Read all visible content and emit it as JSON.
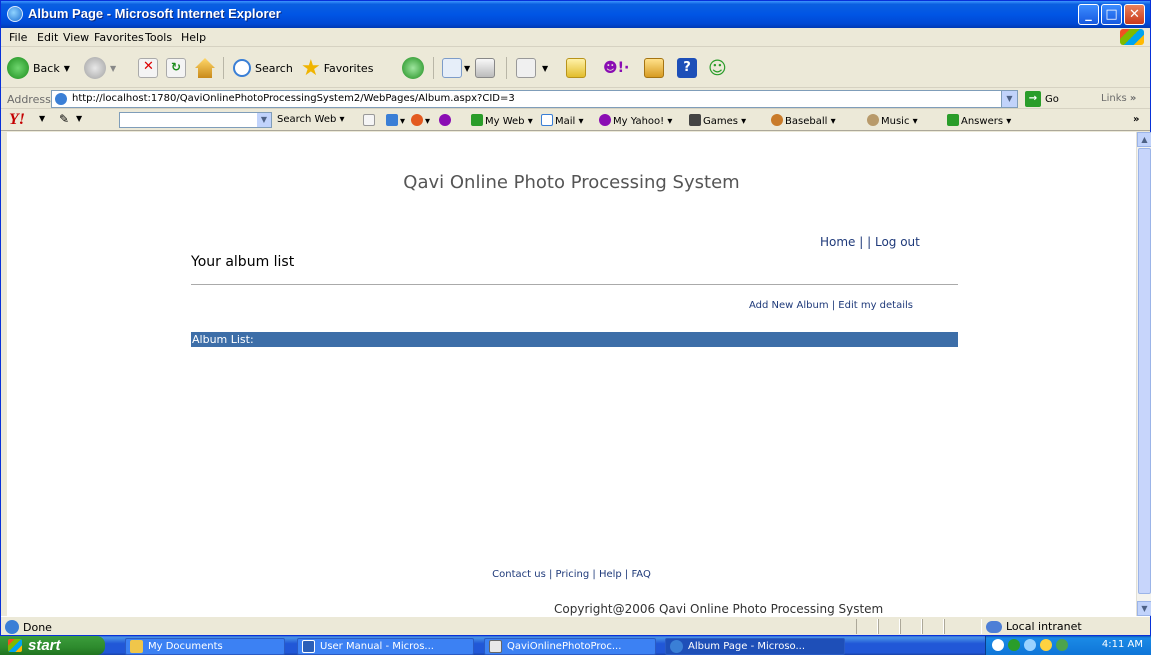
{
  "window": {
    "title": "Album Page - Microsoft Internet Explorer",
    "controls": {
      "minimize": "_",
      "maximize": "□",
      "close": "✕"
    }
  },
  "menu": [
    "File",
    "Edit",
    "View",
    "Favorites",
    "Tools",
    "Help"
  ],
  "toolbar": {
    "back_label": "Back",
    "search_label": "Search",
    "favorites_label": "Favorites"
  },
  "address": {
    "label": "Address",
    "url": "http://localhost:1780/QaviOnlinePhotoProcessingSystem2/WebPages/Album.aspx?CID=3",
    "go_label": "Go",
    "links_label": "Links",
    "more": "»"
  },
  "yahoo_toolbar": {
    "logo": "Y!",
    "search_value": "",
    "search_web_label": "Search Web",
    "items": [
      "My Web",
      "Mail",
      "My Yahoo!",
      "Games",
      "Baseball",
      "Music",
      "Answers"
    ],
    "more": "»"
  },
  "page": {
    "site_title": "Qavi Online Photo Processing System",
    "nav_links": "Home |   | Log out",
    "heading": "Your album list",
    "action_links": "Add New Album | Edit my details",
    "album_header": "Album List:",
    "footer_links": "Contact us | Pricing | Help | FAQ",
    "copyright": "Copyright@2006 Qavi Online Photo Processing System"
  },
  "status": {
    "text": "Done",
    "zone": "Local intranet"
  },
  "taskbar": {
    "start_label": "start",
    "tasks": [
      "My Documents",
      "User Manual - Micros...",
      "QaviOnlinePhotoProc...",
      "Album Page - Microso..."
    ],
    "clock": "4:11 AM"
  },
  "colors": {
    "album_header_bg": "#3d6ea8",
    "link": "#1f3a7a",
    "title_text": "#555555"
  }
}
